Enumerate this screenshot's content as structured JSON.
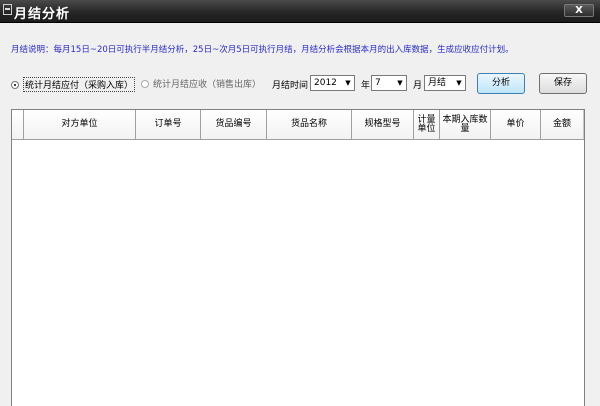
{
  "window": {
    "title": "月结分析",
    "close_label": "X"
  },
  "instructions": "月结说明：每月15日~20日可执行半月结分析，25日~次月5日可执行月结，月结分析会根据本月的出入库数据，生成应收应付计划。",
  "options": {
    "payable": {
      "label": "统计月结应付（采购入库）",
      "checked": true
    },
    "receivable": {
      "label": "统计月结应收（销售出库）",
      "checked": false
    }
  },
  "period": {
    "label": "月结时间",
    "year": "2012",
    "year_unit": "年",
    "month": "7",
    "month_unit": "月",
    "type": "月结"
  },
  "buttons": {
    "analyze": "分析",
    "save": "保存"
  },
  "table": {
    "columns": [
      "对方单位",
      "订单号",
      "货品编号",
      "货品名称",
      "规格型号",
      "计量单位",
      "本期入库数量",
      "单价",
      "金额"
    ],
    "rows": []
  },
  "colors": {
    "instructions": "#2a2ad0",
    "title_bar": "#262626"
  }
}
